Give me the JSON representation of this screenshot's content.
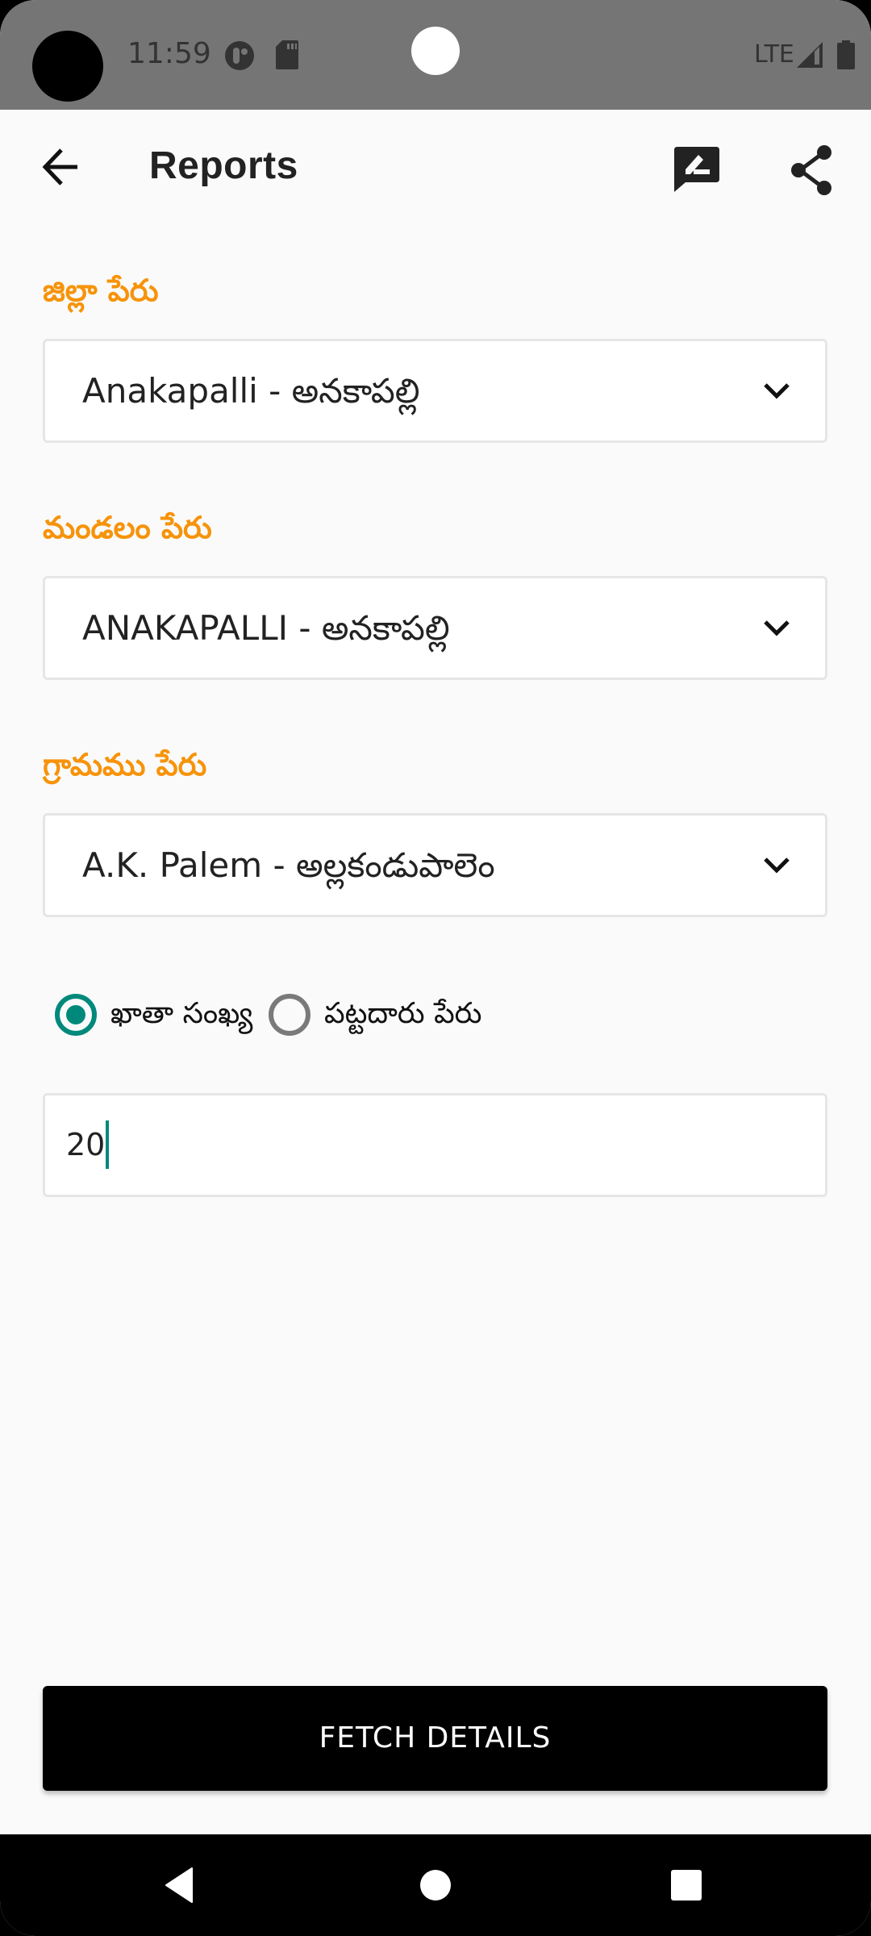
{
  "status_bar": {
    "time": "11:59",
    "network": "LTE",
    "icons": [
      "camera-cutout",
      "app-notification-icon",
      "sd-card-icon",
      "signal-icon",
      "battery-icon"
    ]
  },
  "app_bar": {
    "title": "Reports",
    "back_icon": "arrow-left",
    "actions": [
      {
        "name": "feedback",
        "icon": "rate-review-icon"
      },
      {
        "name": "share",
        "icon": "share-icon"
      }
    ]
  },
  "form": {
    "district": {
      "label": "జిల్లా పేరు",
      "value": "Anakapalli - అనకాపల్లి"
    },
    "mandal": {
      "label": "మండలం పేరు",
      "value": "ANAKAPALLI - అనకాపల్లి"
    },
    "village": {
      "label": "గ్రామము పేరు",
      "value": "A.K. Palem - అల్లకండుపాలెం"
    },
    "search_type": {
      "options": [
        {
          "label": "ఖాతా సంఖ్య",
          "checked": true
        },
        {
          "label": "పట్టదారు పేరు",
          "checked": false
        }
      ]
    },
    "search_input": {
      "value": "20"
    },
    "submit_label": "FETCH DETAILS"
  },
  "colors": {
    "label_accent": "#f7930a",
    "radio_accent": "#00897b",
    "button_bg": "#000000",
    "status_bar_bg": "#757575"
  },
  "nav_bar": {
    "buttons": [
      "back",
      "home",
      "recents"
    ]
  }
}
